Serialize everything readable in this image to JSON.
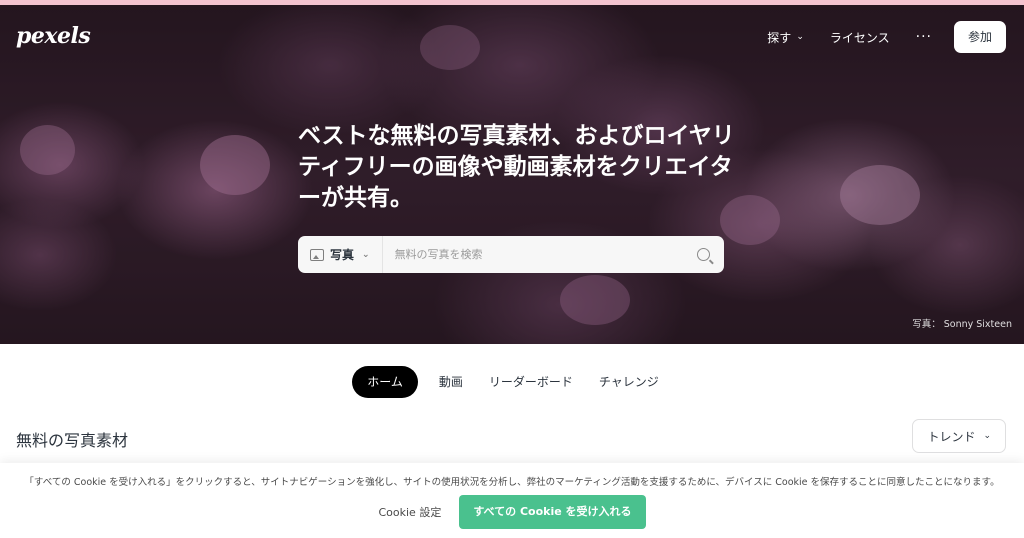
{
  "brand": {
    "logo_text": "pexels"
  },
  "nav": {
    "explore_label": "探す",
    "license_label": "ライセンス",
    "more_label": "···",
    "join_label": "参加"
  },
  "hero": {
    "headline": "ベストな無料の写真素材、およびロイヤリティフリーの画像や動画素材をクリエイターが共有。",
    "photo_credit": "写真： Sonny Sixteen"
  },
  "search": {
    "type_label": "写真",
    "placeholder": "無料の写真を検索"
  },
  "tabs": [
    {
      "label": "ホーム",
      "active": true
    },
    {
      "label": "動画",
      "active": false
    },
    {
      "label": "リーダーボード",
      "active": false
    },
    {
      "label": "チャレンジ",
      "active": false
    }
  ],
  "main": {
    "section_title": "無料の写真素材",
    "sort_label": "トレンド"
  },
  "cookie": {
    "message": "「すべての Cookie を受け入れる」をクリックすると、サイトナビゲーションを強化し、サイトの使用状況を分析し、弊社のマーケティング活動を支援するために、デバイスに Cookie を保存することに同意したことになります。",
    "settings_label": "Cookie 設定",
    "accept_label": "すべての Cookie を受け入れる"
  },
  "colors": {
    "accept_button": "#4ac18e",
    "active_tab": "#000000",
    "top_stripe": "#f3c3cf"
  },
  "icons": [
    "image-icon",
    "chevron-down-icon",
    "search-icon",
    "more-icon"
  ]
}
